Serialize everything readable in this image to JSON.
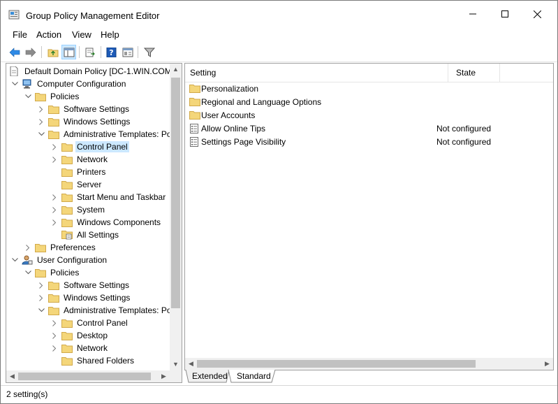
{
  "window": {
    "title": "Group Policy Management Editor",
    "controls": {
      "minimize": "minimize",
      "maximize": "maximize",
      "close": "close"
    }
  },
  "menu": [
    "File",
    "Action",
    "View",
    "Help"
  ],
  "toolbar": {
    "buttons": [
      "back-icon",
      "forward-icon",
      "up-folder-icon",
      "show-hide-tree-icon",
      "export-list-icon",
      "help-icon",
      "properties-icon",
      "filter-icon"
    ]
  },
  "tree": {
    "root": "Default Domain Policy [DC-1.WIN.COM",
    "items": [
      {
        "label": "Computer Configuration"
      },
      {
        "label": "Policies"
      },
      {
        "label": "Software Settings"
      },
      {
        "label": "Windows Settings"
      },
      {
        "label": "Administrative Templates: Po"
      },
      {
        "label": "Control Panel"
      },
      {
        "label": "Network"
      },
      {
        "label": "Printers"
      },
      {
        "label": "Server"
      },
      {
        "label": "Start Menu and Taskbar"
      },
      {
        "label": "System"
      },
      {
        "label": "Windows Components"
      },
      {
        "label": "All Settings"
      },
      {
        "label": "Preferences"
      },
      {
        "label": "User Configuration"
      },
      {
        "label": "Policies"
      },
      {
        "label": "Software Settings"
      },
      {
        "label": "Windows Settings"
      },
      {
        "label": "Administrative Templates: Po"
      },
      {
        "label": "Control Panel"
      },
      {
        "label": "Desktop"
      },
      {
        "label": "Network"
      },
      {
        "label": "Shared Folders"
      }
    ]
  },
  "details": {
    "columns": {
      "setting": "Setting",
      "state": "State"
    },
    "rows": [
      {
        "name": "Personalization",
        "state": "",
        "icon": "folder-icon"
      },
      {
        "name": "Regional and Language Options",
        "state": "",
        "icon": "folder-icon"
      },
      {
        "name": "User Accounts",
        "state": "",
        "icon": "folder-icon"
      },
      {
        "name": "Allow Online Tips",
        "state": "Not configured",
        "icon": "policy-setting-icon"
      },
      {
        "name": "Settings Page Visibility",
        "state": "Not configured",
        "icon": "policy-setting-icon"
      }
    ]
  },
  "tabs": {
    "extended": "Extended",
    "standard": "Standard",
    "active": "Standard"
  },
  "status": {
    "text": "2 setting(s)"
  },
  "colors": {
    "selection": "#cce8ff",
    "folder": "#f4d67a",
    "folder_edge": "#d8b24a",
    "accent": "#1e7bd6"
  }
}
